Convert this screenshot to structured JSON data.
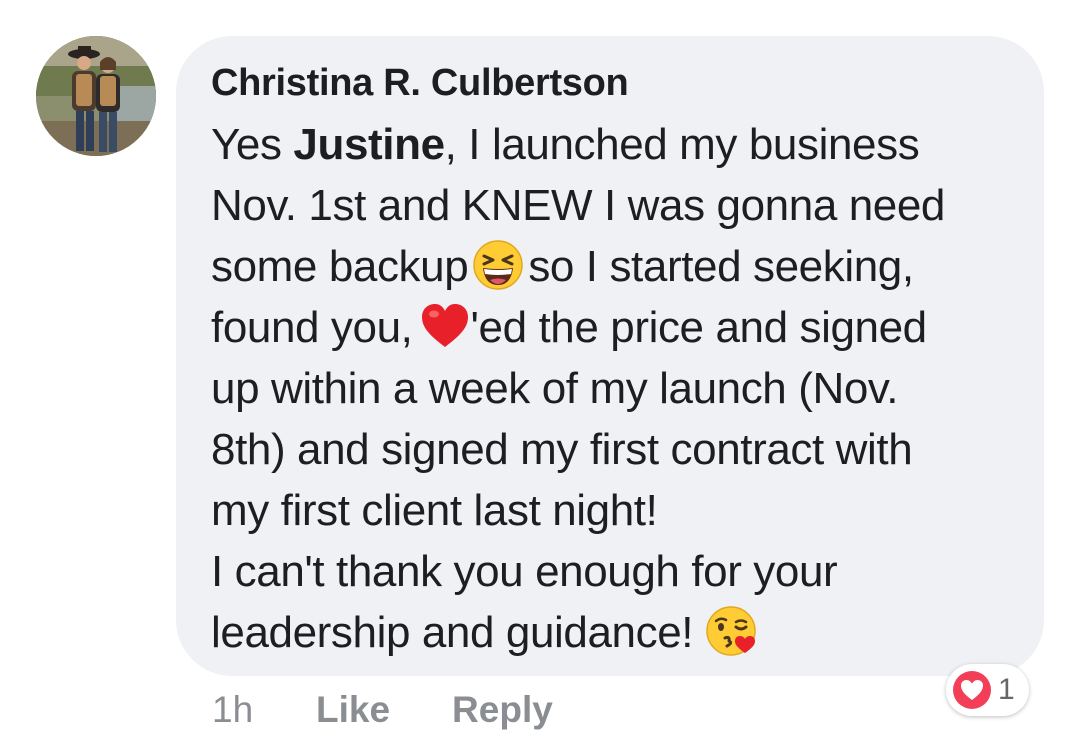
{
  "comment": {
    "author": "Christina R. Culbertson",
    "avatar_icon": "profile-photo-couple",
    "text": {
      "l1_a": "Yes ",
      "l1_mention": "Justine",
      "l1_b": ", I launched my business",
      "l2": "Nov. 1st and KNEW I was gonna need",
      "l3_a": "some backup",
      "l3_emoji": "grinning-squinting-face-icon",
      "l3_b": "so I started seeking,",
      "l4_a": "found you,",
      "l4_emoji": "red-heart-icon",
      "l4_b": "'ed the price and signed",
      "l5": "up within a week of my launch (Nov.",
      "l6": "8th) and signed my first contract with",
      "l7": "my first client last night!",
      "l8": "I can't thank you enough for your",
      "l9_a": "leadership and guidance!",
      "l9_emoji": "face-blowing-kiss-icon"
    },
    "timestamp": "1h",
    "like_label": "Like",
    "reply_label": "Reply",
    "reaction_icon": "love-reaction-icon",
    "reaction_count": "1",
    "colors": {
      "bubble": "#eff1f4",
      "text": "#1c1e21",
      "meta": "#8a8d91",
      "love": "#f33e58"
    }
  }
}
